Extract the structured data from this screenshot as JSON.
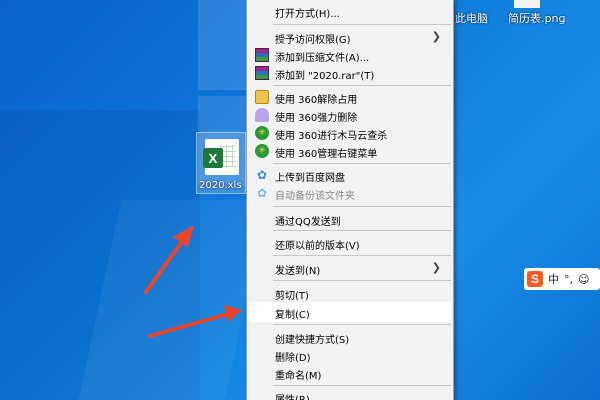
{
  "desktop": {
    "top_labels": [
      "此电脑",
      "简历表.png"
    ],
    "file_icon": {
      "name": "excel-file",
      "label": "2020.xls"
    }
  },
  "context_menu": {
    "items": [
      {
        "label": "打开方式(H)...",
        "icon": "",
        "disabled": false,
        "submenu": false
      },
      {
        "label": "授予访问权限(G)",
        "icon": "",
        "disabled": false,
        "submenu": true
      },
      {
        "label": "添加到压缩文件(A)...",
        "icon": "winrar-icon",
        "disabled": false,
        "submenu": false
      },
      {
        "label": "添加到 \"2020.rar\"(T)",
        "icon": "winrar-icon",
        "disabled": false,
        "submenu": false
      },
      {
        "label": "使用 360解除占用",
        "icon": "360-unlock-icon",
        "disabled": false,
        "submenu": false
      },
      {
        "label": "使用 360强力删除",
        "icon": "360-delete-icon",
        "disabled": false,
        "submenu": false
      },
      {
        "label": "使用 360进行木马云查杀",
        "icon": "360-scan-icon",
        "disabled": false,
        "submenu": false
      },
      {
        "label": "使用 360管理右键菜单",
        "icon": "360-manage-icon",
        "disabled": false,
        "submenu": false
      },
      {
        "label": "上传到百度网盘",
        "icon": "baidu-cloud-icon",
        "disabled": false,
        "submenu": false
      },
      {
        "label": "自动备份该文件夹",
        "icon": "baidu-cloud-icon",
        "disabled": true,
        "submenu": false
      },
      {
        "label": "通过QQ发送到",
        "icon": "",
        "disabled": false,
        "submenu": false
      },
      {
        "label": "还原以前的版本(V)",
        "icon": "",
        "disabled": false,
        "submenu": false
      },
      {
        "label": "发送到(N)",
        "icon": "",
        "disabled": false,
        "submenu": true
      },
      {
        "label": "剪切(T)",
        "icon": "",
        "disabled": false,
        "submenu": false
      },
      {
        "label": "复制(C)",
        "icon": "",
        "disabled": false,
        "submenu": false,
        "highlighted": true
      },
      {
        "label": "创建快捷方式(S)",
        "icon": "",
        "disabled": false,
        "submenu": false
      },
      {
        "label": "删除(D)",
        "icon": "",
        "disabled": false,
        "submenu": false
      },
      {
        "label": "重命名(M)",
        "icon": "",
        "disabled": false,
        "submenu": false
      },
      {
        "label": "属性(R)",
        "icon": "",
        "disabled": false,
        "submenu": false
      }
    ]
  },
  "ime": {
    "logo": "S",
    "mode": "中",
    "punct": "°,",
    "extra": "☺"
  },
  "colors": {
    "arrow": "#e8452c",
    "menu_bg": "#f2f2f2",
    "desktop": "#0d78d8"
  }
}
